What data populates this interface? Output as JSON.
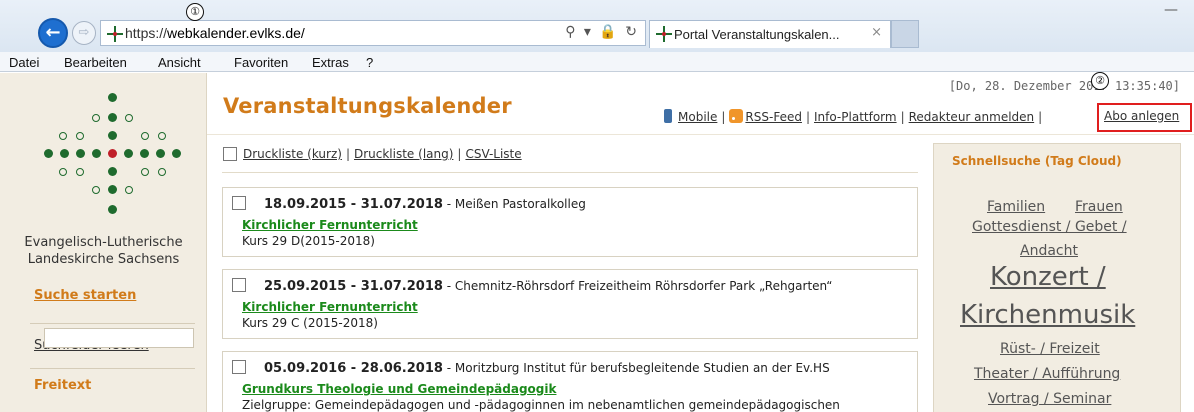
{
  "browser": {
    "url_prefix": "https://",
    "url_host": "webkalender.evlks.de/",
    "address_tools": "⚲ ▾ 🔒 ↻",
    "tab_title": "Portal Veranstaltungskalen...",
    "tab_close": "×",
    "window_min": "—",
    "back_glyph": "←",
    "forward_glyph": "⇨",
    "callout_1": "①",
    "callout_2": "②",
    "menu": [
      "Datei",
      "Bearbeiten",
      "Ansicht",
      "Favoriten",
      "Extras",
      "?"
    ]
  },
  "sidebar": {
    "org_line1": "Evangelisch-Lutherische",
    "org_line2": "Landeskirche Sachsens",
    "search_start": "Suche starten",
    "clear_fields": "Suchfelder leeren",
    "freitext_label": "Freitext",
    "colors": {
      "link_orange": "#d17b1a",
      "background": "#f2ede2",
      "logo_green": "#1f6b2e",
      "logo_red": "#c0202a"
    }
  },
  "header": {
    "title": "Veranstaltungskalender",
    "timestamp": "[Do, 28. Dezember 2017  13:35:40]",
    "links": {
      "mobile": "Mobile",
      "rss": "RSS-Feed",
      "info": "Info-Plattform",
      "editor_login": "Redakteur anmelden",
      "subscribe": "Abo anlegen"
    },
    "separator": "|"
  },
  "exports": {
    "print_short": "Druckliste (kurz)",
    "print_long": "Druckliste (lang)",
    "csv": "CSV-Liste",
    "separator": "|"
  },
  "events": [
    {
      "dates": "18.09.2015  - 31.07.2018",
      "location": " - Meißen Pastoralkolleg",
      "title": "Kirchlicher Fernunterricht",
      "subtitle": "Kurs 29 D(2015-2018)"
    },
    {
      "dates": "25.09.2015  - 31.07.2018",
      "location": " - Chemnitz-Röhrsdorf Freizeitheim Röhrsdorfer Park „Rehgarten“",
      "title": "Kirchlicher Fernunterricht",
      "subtitle": "Kurs 29 C (2015-2018)"
    },
    {
      "dates": "05.09.2016  - 28.06.2018",
      "location": " - Moritzburg Institut für berufsbegleitende Studien an der Ev.HS",
      "title": "Grundkurs Theologie und Gemeindepädagogik",
      "subtitle": "Zielgruppe: Gemeindepädagogen und -pädagoginnen im nebenamtlichen gemeindepädagogischen"
    }
  ],
  "tagcloud": {
    "title": "Schnellsuche (Tag Cloud)",
    "tags": [
      "Familien",
      "Frauen",
      "Gottesdienst / Gebet /",
      "Andacht",
      "Konzert /",
      "Kirchenmusik",
      "Rüst- / Freizeit",
      "Theater / Aufführung",
      "Vortrag / Seminar"
    ]
  }
}
